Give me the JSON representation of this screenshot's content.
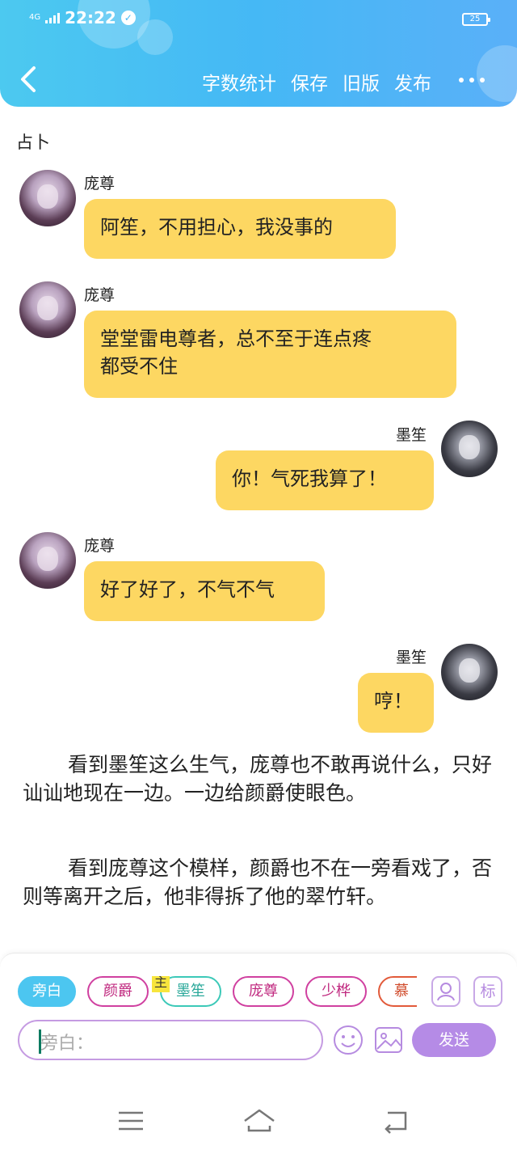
{
  "status_bar": {
    "network": "4G",
    "time": "22:22",
    "battery": "25"
  },
  "header": {
    "menu": [
      "字数统计",
      "保存",
      "旧版",
      "发布"
    ]
  },
  "scene_title": "占卜",
  "messages": [
    {
      "side": "left",
      "name": "庞尊",
      "text": "阿笙，不用担心，我没事的"
    },
    {
      "side": "left",
      "name": "庞尊",
      "lines": [
        "堂堂雷电尊者，总不至于连点疼",
        "都受不住"
      ]
    },
    {
      "side": "right",
      "name": "墨笙",
      "text": "你！气死我算了！"
    },
    {
      "side": "left",
      "name": "庞尊",
      "text": "好了好了，不气不气"
    },
    {
      "side": "right",
      "name": "墨笙",
      "text": "哼！"
    }
  ],
  "narration": [
    "看到墨笙这么生气，庞尊也不敢再说什么，只好讪讪地现在一边。一边给颜爵使眼色。",
    "看到庞尊这个模样，颜爵也不在一旁看戏了，否则等离开之后，他非得拆了他的翠竹轩。"
  ],
  "composer": {
    "chips": [
      "旁白",
      "颜爵",
      "墨笙",
      "庞尊",
      "少桦",
      "慕"
    ],
    "main_tag": "主",
    "person_icon": "person-icon",
    "tag_icon_label": "标",
    "input_placeholder": "旁白：",
    "send_label": "发送"
  },
  "colors": {
    "accent": "#45b8f5",
    "bubble": "#fdd762",
    "send": "#b58be6"
  }
}
